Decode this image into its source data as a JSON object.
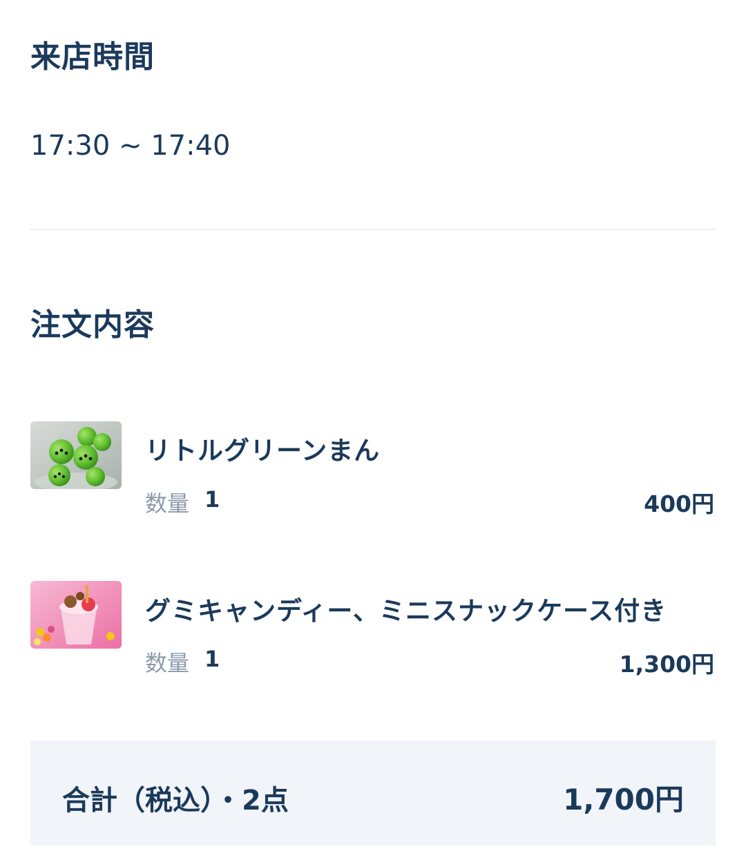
{
  "visit": {
    "title": "来店時間",
    "time_range": "17:30 ~ 17:40"
  },
  "order": {
    "title": "注文内容",
    "items": [
      {
        "name": "リトルグリーンまん",
        "quantity_label": "数量",
        "quantity": "1",
        "price": "400円",
        "thumbnail_icon": "little-green-men-buns-image"
      },
      {
        "name": "グミキャンディー、ミニスナックケース付き",
        "quantity_label": "数量",
        "quantity": "1",
        "price": "1,300円",
        "thumbnail_icon": "gummy-candy-snack-case-image"
      }
    ]
  },
  "total": {
    "label": "合計（税込）・2点",
    "value": "1,700円"
  },
  "colors": {
    "text": "#1b3a5b",
    "muted": "#8a99ab",
    "divider": "#e8edf3",
    "total_bg": "#f1f4f8"
  }
}
